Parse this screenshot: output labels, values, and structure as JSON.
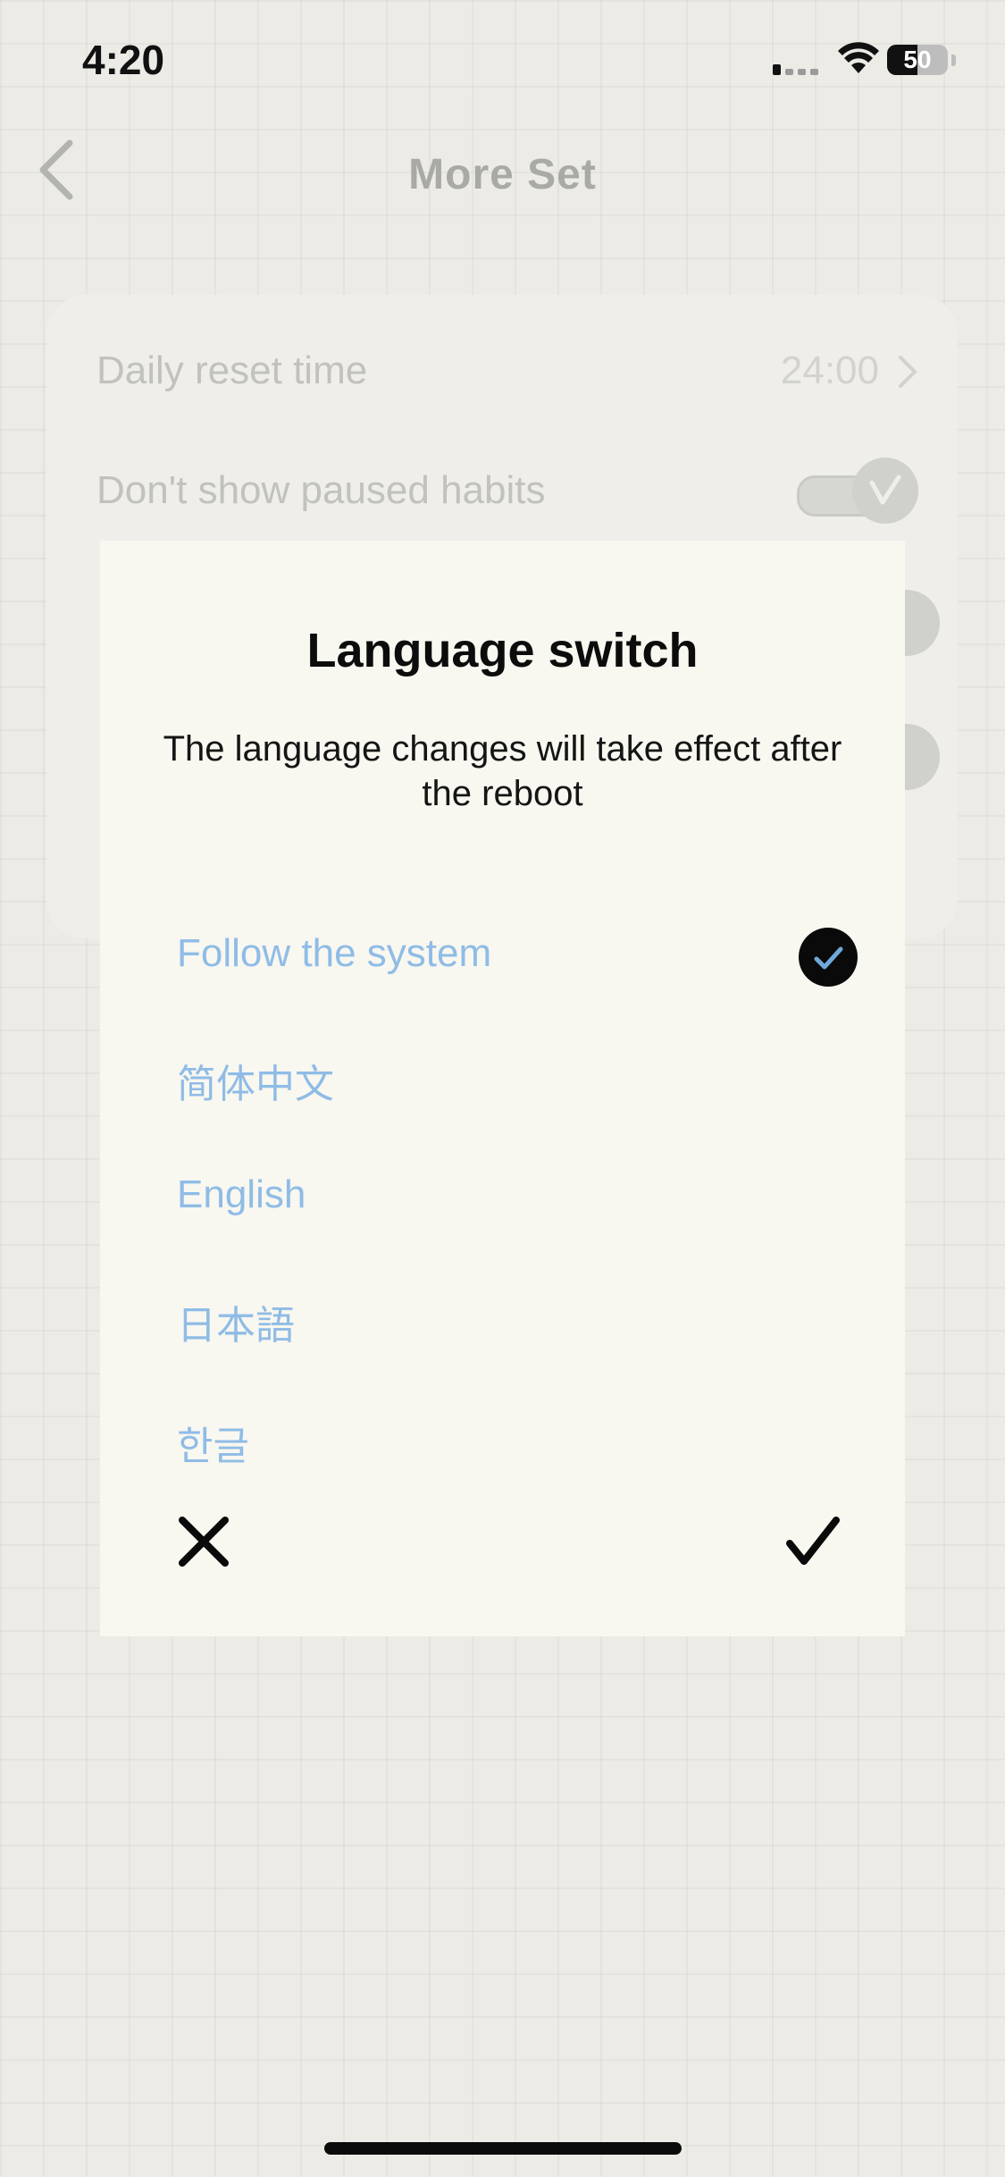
{
  "status_bar": {
    "time": "4:20",
    "battery_text": "50",
    "battery_level": 0.5
  },
  "nav": {
    "title": "More Set"
  },
  "settings": {
    "daily_reset": {
      "label": "Daily reset time",
      "value": "24:00"
    },
    "paused_habits": {
      "label": "Don't show paused habits",
      "enabled": true
    }
  },
  "dialog": {
    "title": "Language switch",
    "description": "The language changes will take effect after the reboot",
    "options": [
      {
        "label": "Follow the system",
        "selected": true
      },
      {
        "label": "简体中文",
        "selected": false
      },
      {
        "label": "English",
        "selected": false
      },
      {
        "label": "日本語",
        "selected": false
      },
      {
        "label": "한글",
        "selected": false
      }
    ],
    "cancel_icon": "close-icon",
    "confirm_icon": "checkmark-icon"
  },
  "colors": {
    "option_text": "#8fbce6",
    "check_badge": "#0a0a0a",
    "check_mark": "#6fa9da",
    "modal_bg": "#f8f7f0",
    "page_bg": "#ecebe6"
  }
}
